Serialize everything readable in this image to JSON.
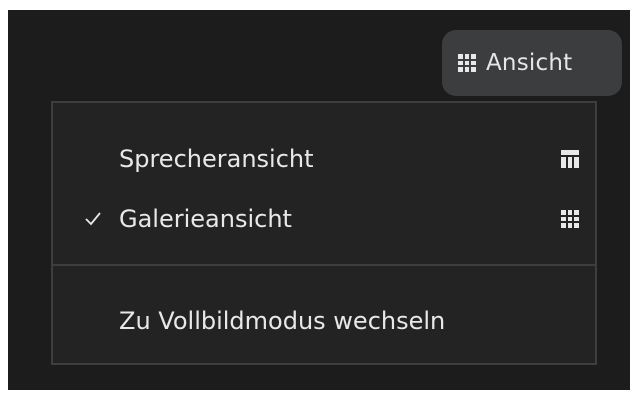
{
  "toolbar": {
    "view_button_label": "Ansicht",
    "view_button_icon": "gallery-grid-icon"
  },
  "view_menu": {
    "items": [
      {
        "label": "Sprecheransicht",
        "checked": false,
        "icon": "speaker-view-icon"
      },
      {
        "label": "Galerieansicht",
        "checked": true,
        "icon": "gallery-grid-icon"
      },
      {
        "label": "Zu Vollbildmodus wechseln",
        "checked": false,
        "icon": ""
      }
    ]
  },
  "colors": {
    "background": "#1c1c1c",
    "menu_background": "#232323",
    "menu_border": "#3e3e3e",
    "button_background": "#3b3d3f",
    "text": "#e8e8e8"
  }
}
